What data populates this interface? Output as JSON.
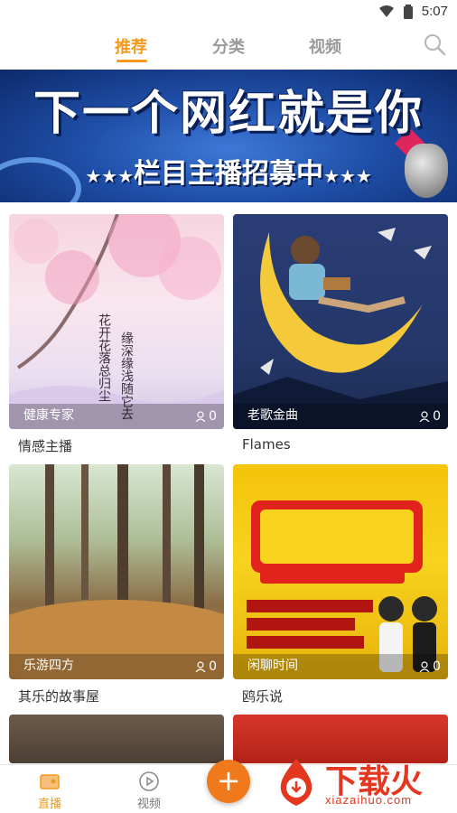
{
  "status_bar": {
    "time": "5:07"
  },
  "top_tabs": [
    {
      "label": "推荐",
      "active": true
    },
    {
      "label": "分类",
      "active": false
    },
    {
      "label": "视频",
      "active": false
    }
  ],
  "banner": {
    "title": "下一个网红就是你",
    "subtitle": "栏目主播招募中",
    "stars_left": "★★★",
    "stars_right": "★★★"
  },
  "cards": [
    {
      "tag": "健康专家",
      "viewers": "0",
      "title": "情感主播"
    },
    {
      "tag": "老歌金曲",
      "viewers": "0",
      "title": "Flames"
    },
    {
      "tag": "乐游四方",
      "viewers": "0",
      "title": "其乐的故事屋"
    },
    {
      "tag": "闲聊时间",
      "viewers": "0",
      "title": "鸥乐说"
    }
  ],
  "bottom_nav": [
    {
      "label": "直播",
      "icon": "live-tv-icon",
      "active": true
    },
    {
      "label": "视频",
      "icon": "play-circle-icon",
      "active": false
    }
  ],
  "fab": {
    "icon": "plus-icon",
    "label": "+"
  },
  "watermark": {
    "text": "下载火",
    "url": "xiazaihuo.com"
  },
  "colors": {
    "accent": "#f39a1e",
    "fab": "#f07a1b",
    "watermark": "#e3381f"
  }
}
